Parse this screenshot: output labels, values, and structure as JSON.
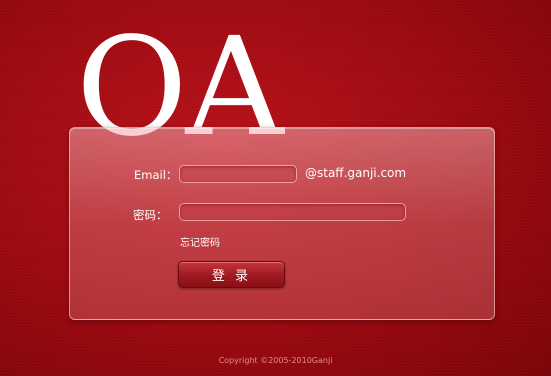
{
  "logo": {
    "text": "OA"
  },
  "form": {
    "email_label": "Email：",
    "email_value": "",
    "email_domain": "@staff.ganji.com",
    "password_label": "密码：",
    "password_value": "",
    "forgot_password": "忘记密码",
    "login_button": "登 录"
  },
  "footer": {
    "copyright": "Copyright ©2005-2010Ganji"
  },
  "colors": {
    "background": "#9a0a10",
    "panel": "#d46a70",
    "text": "#ffffff"
  }
}
